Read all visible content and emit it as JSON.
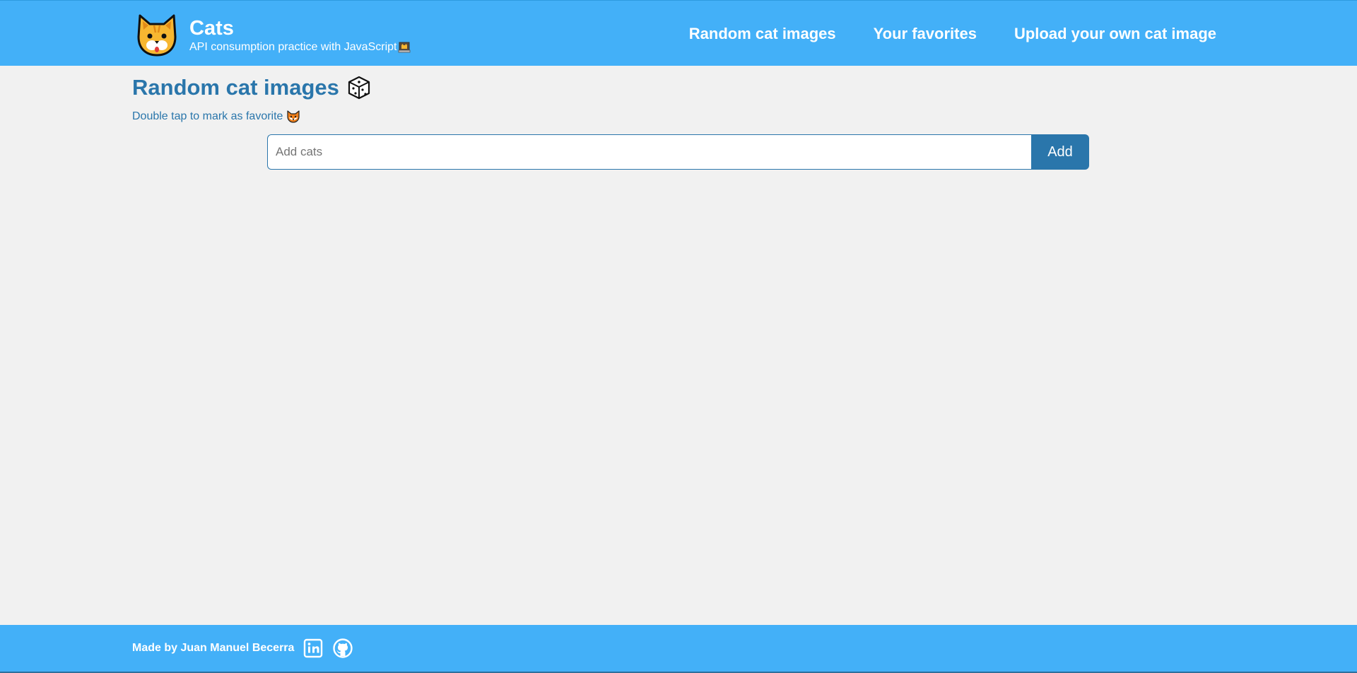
{
  "header": {
    "title": "Cats",
    "subtitle": "API consumption practice with JavaScript",
    "logo_icon": "cat-face-icon",
    "subtitle_icon": "laptop-cat-icon",
    "nav": [
      {
        "label": "Random cat images"
      },
      {
        "label": "Your favorites"
      },
      {
        "label": "Upload your own cat image"
      }
    ]
  },
  "main": {
    "title": "Random cat images",
    "title_icon": "dice-icon",
    "subtitle": "Double tap to mark as favorite",
    "subtitle_icon": "fox-face-icon",
    "add_input": {
      "placeholder": "Add cats",
      "value": ""
    },
    "add_button_label": "Add"
  },
  "footer": {
    "text": "Made by Juan Manuel Becerra",
    "links": [
      {
        "icon": "linkedin-icon"
      },
      {
        "icon": "github-icon"
      }
    ]
  },
  "colors": {
    "header_bg": "#43b0f8",
    "accent": "#2a76ab",
    "page_bg": "#f1f1f1"
  }
}
